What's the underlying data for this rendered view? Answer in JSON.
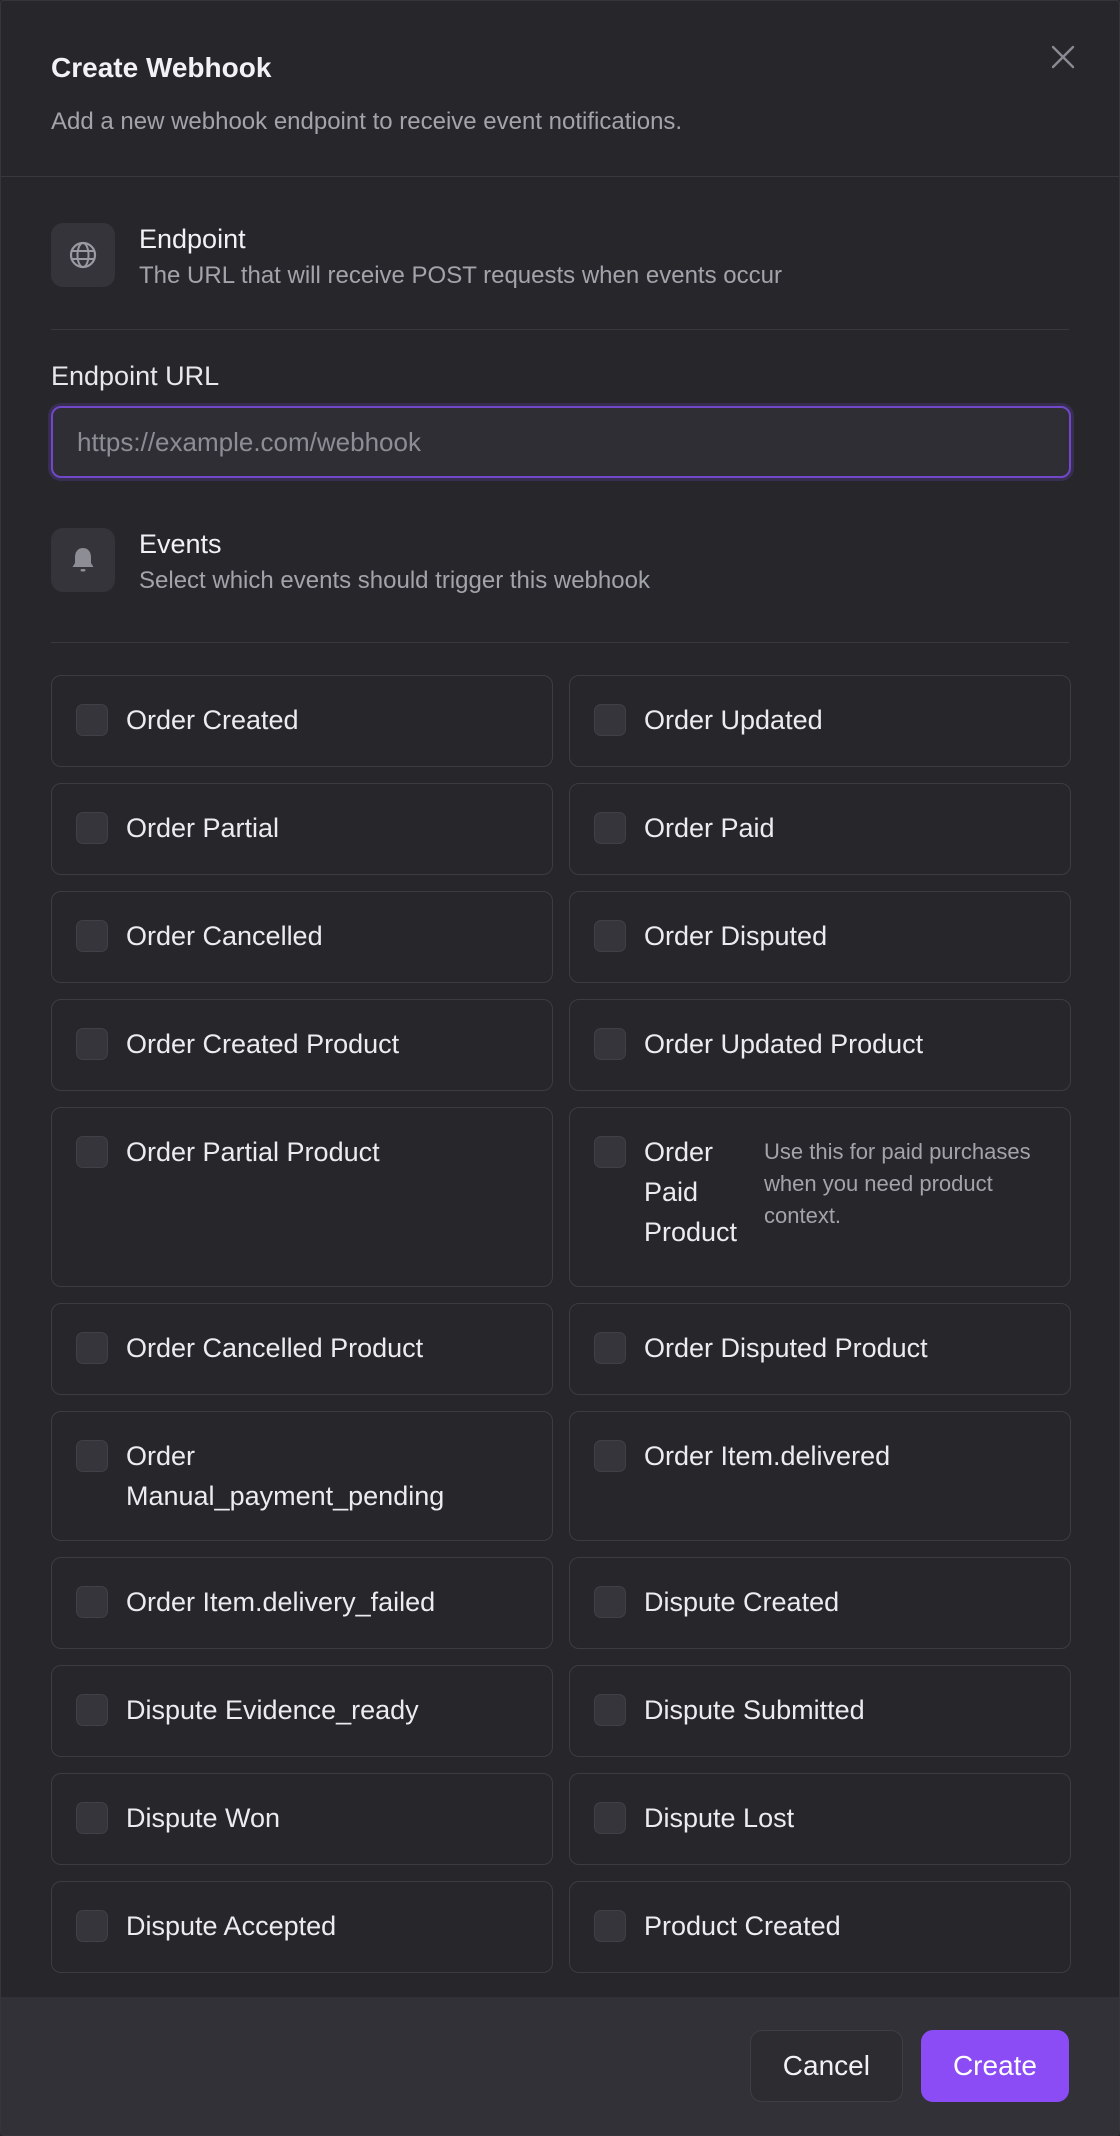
{
  "dialog": {
    "title": "Create Webhook",
    "subtitle": "Add a new webhook endpoint to receive event notifications."
  },
  "endpoint_section": {
    "title": "Endpoint",
    "description": "The URL that will receive POST requests when events occur",
    "icon": "globe-icon"
  },
  "endpoint_url": {
    "label": "Endpoint URL",
    "value": "",
    "placeholder": "https://example.com/webhook"
  },
  "events_section": {
    "title": "Events",
    "description": "Select which events should trigger this webhook",
    "icon": "bell-icon"
  },
  "events": [
    {
      "label": "Order Created",
      "checked": false
    },
    {
      "label": "Order Updated",
      "checked": false
    },
    {
      "label": "Order Partial",
      "checked": false
    },
    {
      "label": "Order Paid",
      "checked": false
    },
    {
      "label": "Order Cancelled",
      "checked": false
    },
    {
      "label": "Order Disputed",
      "checked": false
    },
    {
      "label": "Order Created Product",
      "checked": false
    },
    {
      "label": "Order Updated Product",
      "checked": false
    },
    {
      "label": "Order Partial Product",
      "checked": false
    },
    {
      "label": "Order Paid Product",
      "checked": false,
      "hint": "Use this for paid purchases when you need product context."
    },
    {
      "label": "Order Cancelled Product",
      "checked": false
    },
    {
      "label": "Order Disputed Product",
      "checked": false
    },
    {
      "label": "Order Manual_payment_pending",
      "checked": false
    },
    {
      "label": "Order Item.delivered",
      "checked": false
    },
    {
      "label": "Order Item.delivery_failed",
      "checked": false
    },
    {
      "label": "Dispute Created",
      "checked": false
    },
    {
      "label": "Dispute Evidence_ready",
      "checked": false
    },
    {
      "label": "Dispute Submitted",
      "checked": false
    },
    {
      "label": "Dispute Won",
      "checked": false
    },
    {
      "label": "Dispute Lost",
      "checked": false
    },
    {
      "label": "Dispute Accepted",
      "checked": false
    },
    {
      "label": "Product Created",
      "checked": false
    }
  ],
  "footer": {
    "cancel_label": "Cancel",
    "create_label": "Create"
  },
  "colors": {
    "background": "#26262b",
    "accent": "#8c4cf5",
    "input_focus": "#7048c8",
    "footer": "#313137"
  }
}
